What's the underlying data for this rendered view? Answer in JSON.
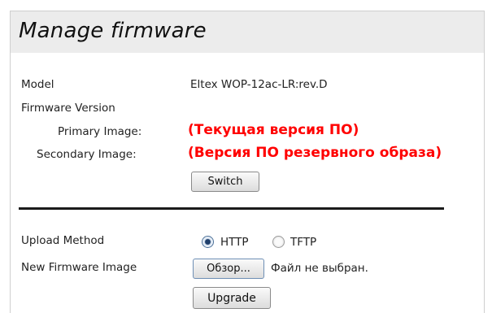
{
  "header": {
    "title": "Manage firmware"
  },
  "model": {
    "label": "Model",
    "value": "Eltex WOP-12ac-LR:rev.D"
  },
  "firmware_version": {
    "label": "Firmware Version",
    "primary_label": "Primary Image:",
    "primary_value": "(Текущая версия ПО)",
    "secondary_label": "Secondary Image:",
    "secondary_value": "(Версия ПО резервного образа)",
    "switch_label": "Switch"
  },
  "upload": {
    "label": "Upload Method",
    "options": [
      {
        "label": "HTTP",
        "selected": true
      },
      {
        "label": "TFTP",
        "selected": false
      }
    ]
  },
  "new_image": {
    "label": "New Firmware Image",
    "browse_label": "Обзор...",
    "file_status": "Файл не выбран.",
    "upgrade_label": "Upgrade"
  },
  "colors": {
    "header_bg": "#ececec",
    "annotation_red": "#ff0000"
  }
}
